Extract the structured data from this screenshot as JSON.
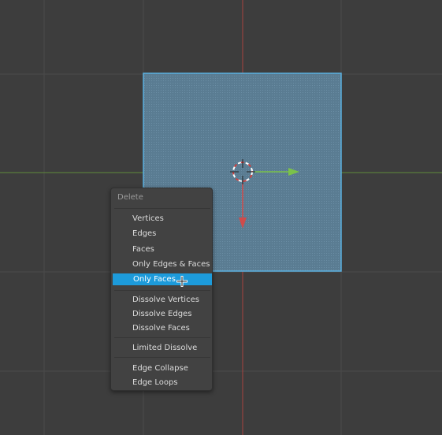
{
  "menu": {
    "title": "Delete",
    "items": [
      {
        "label": "Vertices"
      },
      {
        "label": "Edges"
      },
      {
        "label": "Faces"
      },
      {
        "label": "Only Edges & Faces"
      },
      {
        "label": "Only Faces",
        "active": true
      },
      {
        "label": "Dissolve Vertices"
      },
      {
        "label": "Dissolve Edges"
      },
      {
        "label": "Dissolve Faces"
      },
      {
        "label": "Limited Dissolve"
      },
      {
        "label": "Edge Collapse"
      },
      {
        "label": "Edge Loops"
      }
    ]
  },
  "colors": {
    "background": "#3d3d3d",
    "grid_line": "#4a4a4a",
    "x_axis": "#cf4b4b",
    "y_axis": "#7bbf3a",
    "face_fill": "#5c7f96",
    "face_edge": "#5ab0e0",
    "highlight": "#1d9bdb"
  },
  "icons": [
    "3d-cursor-icon",
    "move-gizmo-x-arrow-icon",
    "move-gizmo-y-arrow-icon",
    "mouse-cursor-icon"
  ]
}
